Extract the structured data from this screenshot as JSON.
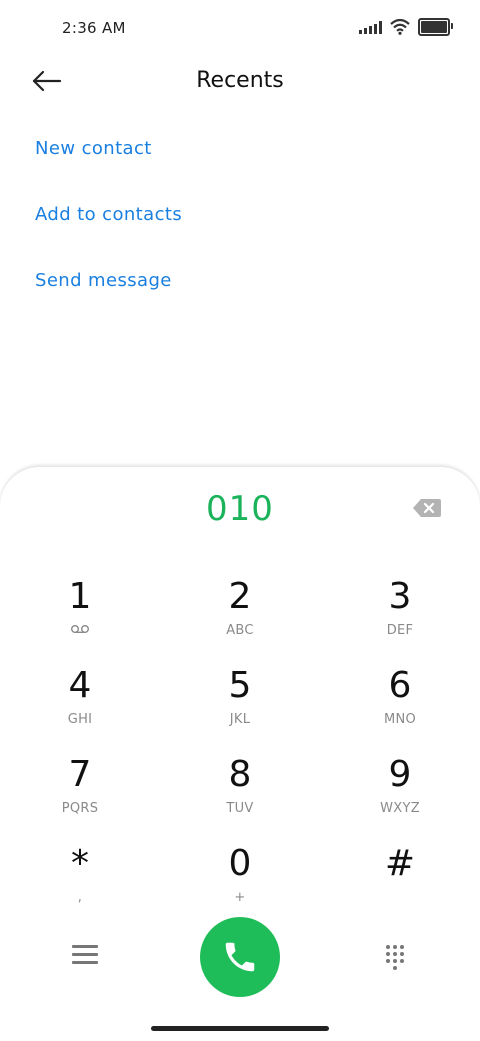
{
  "status_bar": {
    "time": "2:36 AM",
    "icons": [
      "signal-icon",
      "wifi-icon",
      "battery-icon"
    ]
  },
  "header": {
    "title": "Recents",
    "back_icon": "back-arrow-icon"
  },
  "actions": [
    {
      "label": "New contact"
    },
    {
      "label": "Add to contacts"
    },
    {
      "label": "Send message"
    }
  ],
  "dialer": {
    "number": "010",
    "number_color": "#1ab35a",
    "backspace_icon": "backspace-icon",
    "keys": [
      {
        "digit": "1",
        "letters": "",
        "sub_icon": "voicemail-icon"
      },
      {
        "digit": "2",
        "letters": "ABC"
      },
      {
        "digit": "3",
        "letters": "DEF"
      },
      {
        "digit": "4",
        "letters": "GHI"
      },
      {
        "digit": "5",
        "letters": "JKL"
      },
      {
        "digit": "6",
        "letters": "MNO"
      },
      {
        "digit": "7",
        "letters": "PQRS"
      },
      {
        "digit": "8",
        "letters": "TUV"
      },
      {
        "digit": "9",
        "letters": "WXYZ"
      },
      {
        "digit": "*",
        "letters": ","
      },
      {
        "digit": "0",
        "letters": "+"
      },
      {
        "digit": "#",
        "letters": ""
      }
    ]
  },
  "bottom_bar": {
    "menu_icon": "menu-icon",
    "call_icon": "phone-icon",
    "call_color": "#1fbd5a",
    "keypad_icon": "keypad-icon"
  },
  "colors": {
    "accent_link": "#1a7fe0",
    "dial_green": "#1ab35a"
  }
}
